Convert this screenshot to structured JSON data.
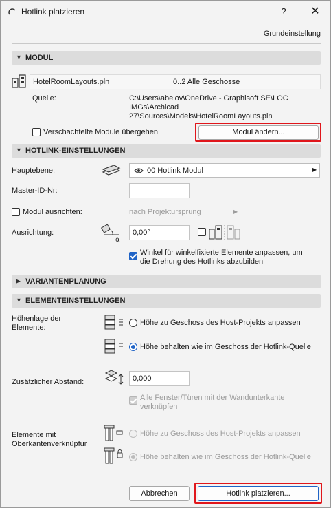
{
  "window": {
    "title": "Hotlink platzieren",
    "help_label": "?",
    "close_label": "✕"
  },
  "preset_label": "Grundeinstellung",
  "sections": {
    "modul": "MODUL",
    "hotlink": "HOTLINK-EINSTELLUNGEN",
    "varianten": "VARIANTENPLANUNG",
    "elemente": "ELEMENTEINSTELLUNGEN"
  },
  "modul": {
    "file_name": "HotelRoomLayouts.pln",
    "stories": "0..2 Alle Geschosse",
    "source_label": "Quelle:",
    "source_path_lines": [
      "C:\\Users\\abelov\\OneDrive - Graphisoft SE\\LOC",
      "IMGs\\Archicad",
      "27\\Sources\\Models\\HotelRoomLayouts.pln"
    ],
    "skip_nested_label": "Verschachtelte Module übergehen",
    "change_button": "Modul ändern..."
  },
  "hotlink": {
    "main_story_label": "Hauptebene:",
    "main_story_value": "00 Hotlink Modul",
    "master_id_label": "Master-ID-Nr:",
    "master_id_value": "",
    "align_label": "Modul ausrichten:",
    "align_value": "nach Projektursprung",
    "orientation_label": "Ausrichtung:",
    "orientation_value": "0,00°",
    "angle_check_label_lines": [
      "Winkel für winkelfixierte Elemente anpassen, um",
      "die Drehung des Hotlinks abzubilden"
    ]
  },
  "elements": {
    "height_label_lines": [
      "Höhenlage der",
      "Elemente:"
    ],
    "height_option1": "Höhe zu Geschoss des Host-Projekts anpassen",
    "height_option2": "Höhe behalten wie im Geschoss der Hotlink-Quelle",
    "extra_offset_label": "Zusätzlicher Abstand:",
    "extra_offset_value": "0,000",
    "doors_label_lines": [
      "Alle Fenster/Türen mit der Wandunterkante",
      "verknüpfen"
    ],
    "top_link_label_lines": [
      "Elemente mit",
      "Oberkantenverknüpfur"
    ],
    "top_option1": "Höhe zu Geschoss des Host-Projekts anpassen",
    "top_option2": "Höhe behalten wie im Geschoss der Hotlink-Quelle"
  },
  "footer": {
    "cancel": "Abbrechen",
    "place": "Hotlink platzieren..."
  },
  "colors": {
    "accent": "#1f63c6",
    "highlight": "#e0161b",
    "section_bg": "#dcdcdc"
  }
}
